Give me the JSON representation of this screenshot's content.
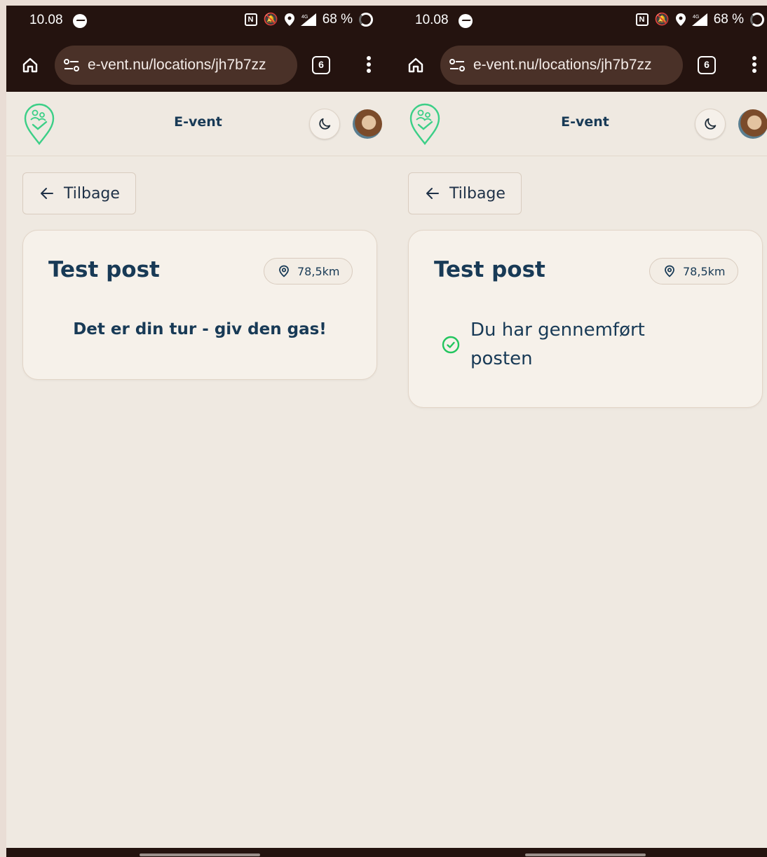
{
  "status_bar": {
    "time": "10.08",
    "nfc": "N",
    "network": "4G",
    "battery": "68 %"
  },
  "browser": {
    "url": "e-vent.nu/locations/jh7b7zz",
    "tab_count": "6"
  },
  "app": {
    "title": "E-vent",
    "back_label": "Tilbage"
  },
  "screens": [
    {
      "post_title": "Test post",
      "distance": "78,5km",
      "message": "Det er din tur - giv den gas!"
    },
    {
      "post_title": "Test post",
      "distance": "78,5km",
      "completed_message": "Du har gennemført posten"
    }
  ],
  "colors": {
    "chrome": "#24130f",
    "url_pill": "#4a3128",
    "page_bg": "#efe9e1",
    "text_primary": "#183a56",
    "logo_accent": "#3ccf87",
    "success": "#22c55e"
  },
  "icons": {
    "home": "home-icon",
    "tune": "tune-icon",
    "more": "more-vertical-icon",
    "theme": "moon-icon",
    "back": "arrow-left-icon",
    "distance": "location-pin-icon",
    "completed": "check-circle-icon",
    "logo": "e-vent-logo"
  }
}
